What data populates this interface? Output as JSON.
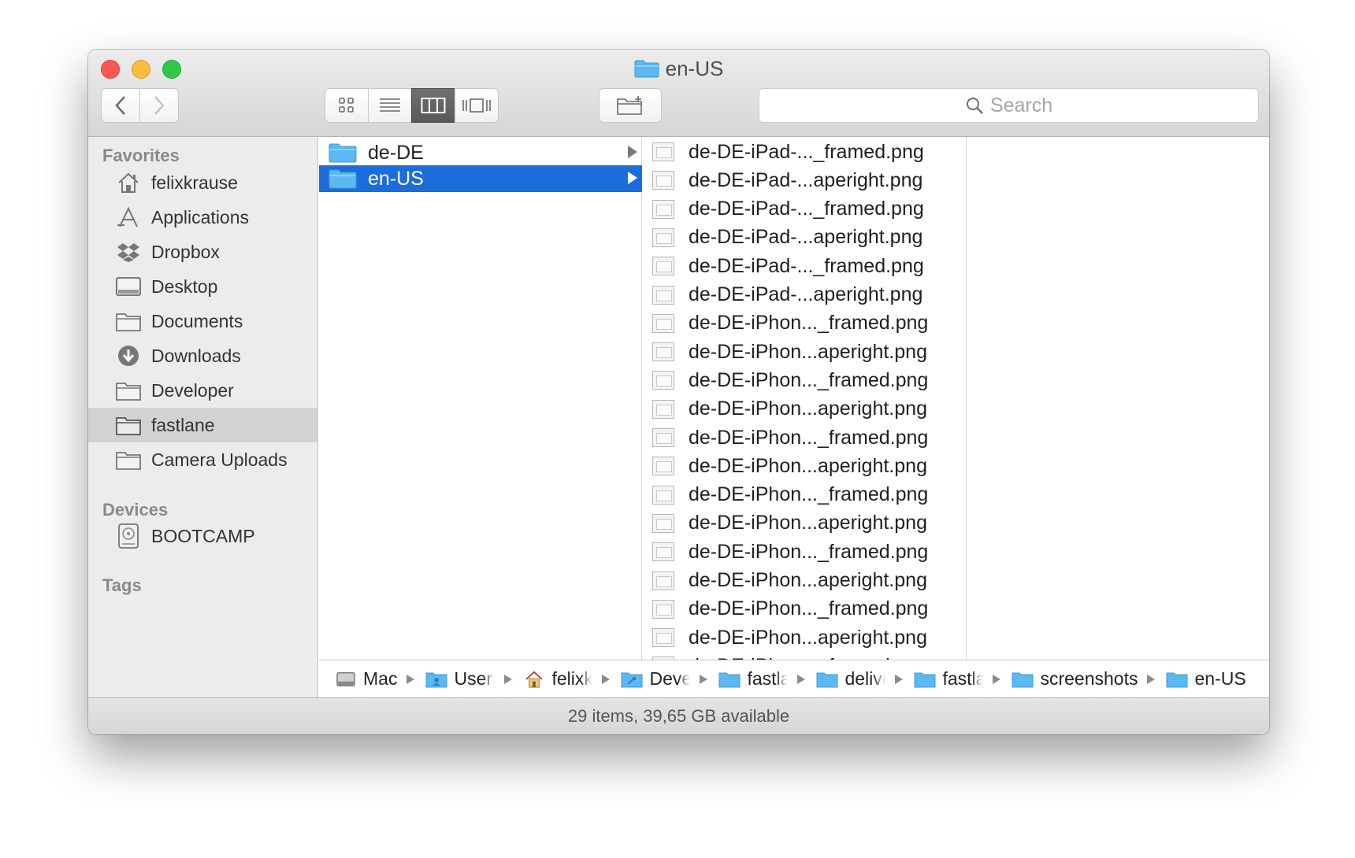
{
  "window": {
    "title": "en-US"
  },
  "toolbar": {
    "back_icon": "chevron-left-icon",
    "forward_icon": "chevron-right-icon",
    "views": [
      "icon-view",
      "list-view",
      "column-view",
      "cover-flow-view"
    ],
    "active_view": "column-view",
    "new_folder_icon": "new-folder-icon",
    "search_placeholder": "Search"
  },
  "sidebar": {
    "favorites_header": "Favorites",
    "favorites": [
      {
        "label": "felixkrause",
        "icon": "home-icon"
      },
      {
        "label": "Applications",
        "icon": "applications-icon"
      },
      {
        "label": "Dropbox",
        "icon": "dropbox-icon"
      },
      {
        "label": "Desktop",
        "icon": "desktop-icon"
      },
      {
        "label": "Documents",
        "icon": "folder-icon"
      },
      {
        "label": "Downloads",
        "icon": "downloads-icon"
      },
      {
        "label": "Developer",
        "icon": "folder-icon"
      },
      {
        "label": "fastlane",
        "icon": "folder-icon",
        "selected": true
      },
      {
        "label": "Camera Uploads",
        "icon": "folder-icon"
      }
    ],
    "devices_header": "Devices",
    "devices": [
      {
        "label": "BOOTCAMP",
        "icon": "disk-icon"
      }
    ],
    "tags_header": "Tags"
  },
  "column1": {
    "items": [
      {
        "label": "de-DE",
        "selected": false
      },
      {
        "label": "en-US",
        "selected": true
      }
    ]
  },
  "column2": {
    "files": [
      "de-DE-iPad-..._framed.png",
      "de-DE-iPad-...aperight.png",
      "de-DE-iPad-..._framed.png",
      "de-DE-iPad-...aperight.png",
      "de-DE-iPad-..._framed.png",
      "de-DE-iPad-...aperight.png",
      "de-DE-iPhon..._framed.png",
      "de-DE-iPhon...aperight.png",
      "de-DE-iPhon..._framed.png",
      "de-DE-iPhon...aperight.png",
      "de-DE-iPhon..._framed.png",
      "de-DE-iPhon...aperight.png",
      "de-DE-iPhon..._framed.png",
      "de-DE-iPhon...aperight.png",
      "de-DE-iPhon..._framed.png",
      "de-DE-iPhon...aperight.png",
      "de-DE-iPhon..._framed.png",
      "de-DE-iPhon...aperight.png",
      "de-DE-iPhon..._framed.png"
    ]
  },
  "pathbar": {
    "crumbs": [
      {
        "label": "Mac",
        "icon": "hard-disk-icon"
      },
      {
        "label": "Users",
        "icon": "users-folder-icon"
      },
      {
        "label": "felixkrause",
        "icon": "home-icon"
      },
      {
        "label": "Developer",
        "icon": "developer-folder-icon"
      },
      {
        "label": "fastlane",
        "icon": "folder-icon"
      },
      {
        "label": "deliver",
        "icon": "folder-icon"
      },
      {
        "label": "fastlane",
        "icon": "folder-icon"
      },
      {
        "label": "screenshots",
        "icon": "folder-icon"
      },
      {
        "label": "en-US",
        "icon": "folder-icon"
      }
    ]
  },
  "statusbar": {
    "text": "29 items, 39,65 GB available"
  },
  "colors": {
    "selection": "#1b6ddb",
    "folder_blue": "#5bb8f0",
    "close": "#fc5753",
    "minimize": "#fdbc40",
    "zoom": "#33c748"
  }
}
